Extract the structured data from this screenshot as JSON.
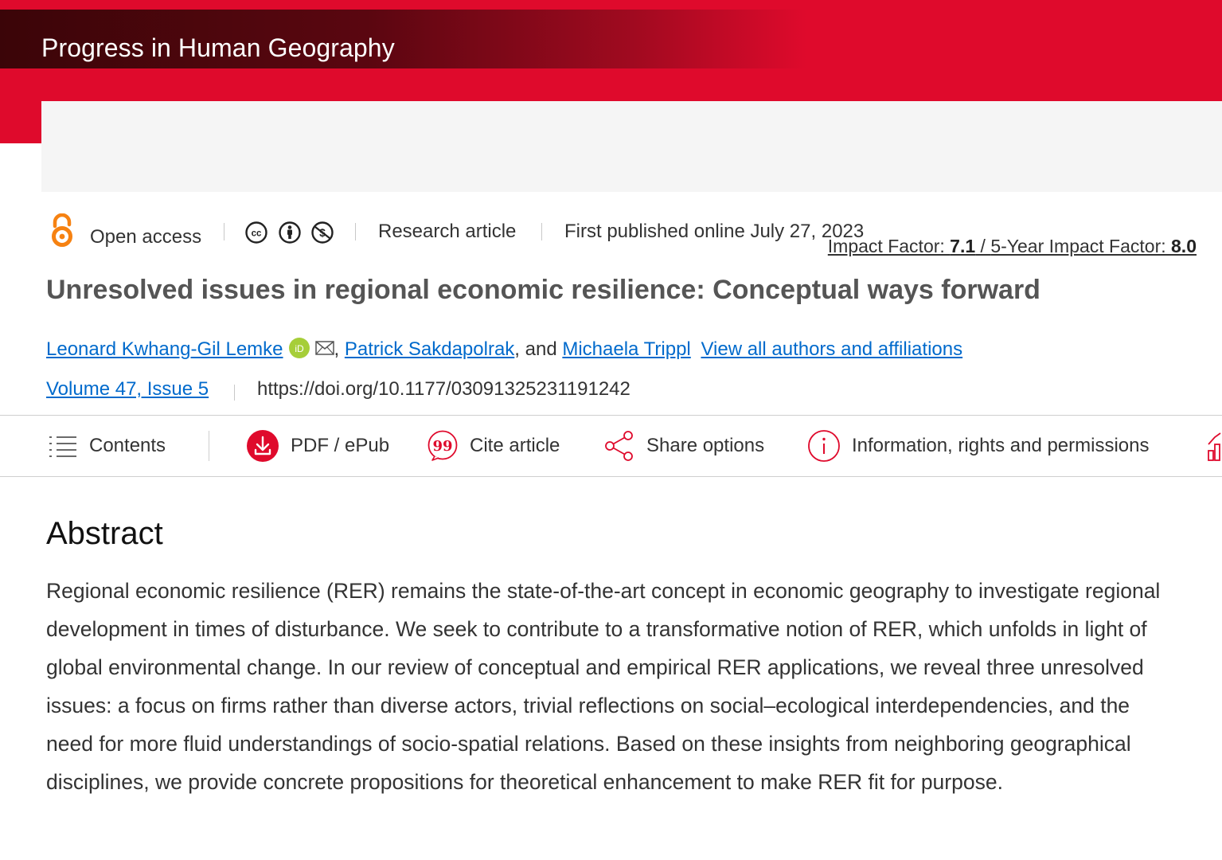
{
  "colors": {
    "brand_red": "#df0a2c",
    "link_blue": "#006acc",
    "open_access_orange": "#f68212",
    "orcid_green": "#a6ce39"
  },
  "header": {
    "journal_title": "Progress in Human Geography"
  },
  "metrics": {
    "impact_label": "Impact Factor: ",
    "impact_value": "7.1",
    "separator": " / ",
    "five_year_label": "5-Year Impact Factor: ",
    "five_year_value": "8.0"
  },
  "meta": {
    "open_access": "Open access",
    "license_icons": [
      "creative-commons-icon",
      "attribution-icon",
      "non-commercial-icon"
    ],
    "article_type": "Research article",
    "published": "First published online July 27, 2023"
  },
  "article": {
    "title": "Unresolved issues in regional economic resilience: Conceptual ways forward",
    "authors": [
      {
        "name": "Leonard Kwhang-Gil Lemke",
        "orcid": true,
        "email": true
      },
      {
        "name": "Patrick Sakdapolrak"
      },
      {
        "name": "Michaela Trippl"
      }
    ],
    "comma": ",",
    "and": ", and",
    "view_all": "View all authors and affiliations",
    "volume": "Volume 47, Issue 5",
    "doi": "https://doi.org/10.1177/03091325231191242"
  },
  "toolbar": {
    "contents": "Contents",
    "pdf": "PDF / ePub",
    "cite": "Cite article",
    "share": "Share options",
    "info": "Information, rights and permissions"
  },
  "abstract": {
    "heading": "Abstract",
    "text": "Regional economic resilience (RER) remains the state-of-the-art concept in economic geography to investigate regional development in times of disturbance. We seek to contribute to a transformative notion of RER, which unfolds in light of global environmental change. In our review of conceptual and empirical RER applications, we reveal three unresolved issues: a focus on firms rather than diverse actors, trivial reflections on social–ecological interdependencies, and the need for more fluid understandings of socio-spatial relations. Based on these insights from neighboring geographical disciplines, we provide concrete propositions for theoretical enhancement to make RER fit for purpose."
  }
}
